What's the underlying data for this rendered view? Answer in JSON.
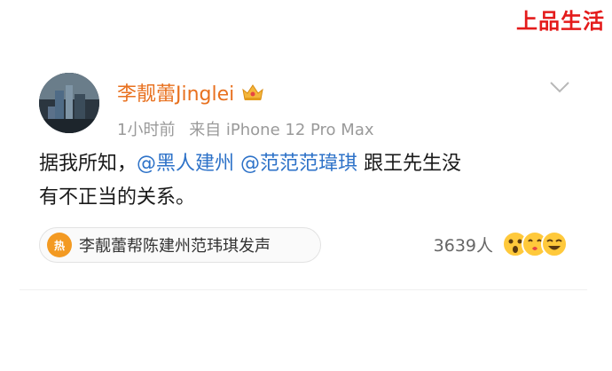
{
  "watermark": "上品生活",
  "post": {
    "username": "李靓蕾Jinglei",
    "time": "1小时前",
    "source": "来自 iPhone 12 Pro Max",
    "body": {
      "line1_prefix": "据我所知，",
      "mention1": "@黑人建州",
      "mention2": "@范范范瑋琪",
      "line1_suffix": " 跟王先生没",
      "line2": "有不正当的关系。"
    },
    "topic": {
      "label": "李靓蕾帮陈建州范玮琪发声",
      "icon_text": "热"
    },
    "reactions": {
      "count": "3639人",
      "emojis": [
        "surprised-emoji",
        "kiss-emoji",
        "laugh-emoji"
      ]
    }
  },
  "colors": {
    "watermark": "#e41b1b",
    "username": "#e8711f",
    "mention": "#2d72c8",
    "meta": "#9a9a9a",
    "emoji": "#ffc93b"
  }
}
